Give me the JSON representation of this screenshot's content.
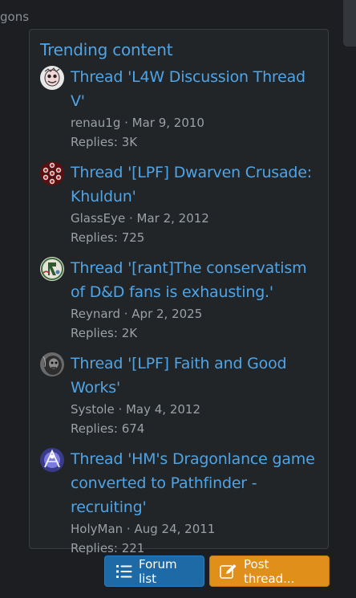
{
  "top_crumb": "gons",
  "panel": {
    "title": "Trending content",
    "items": [
      {
        "title": "Thread 'L4W Discussion Thread V'",
        "author": "renau1g",
        "date": "Mar 9, 2010",
        "replies": "Replies: 3K",
        "avatar_icon": "avatar-renau1g"
      },
      {
        "title": "Thread '[LPF] Dwarven Crusade: Khuldun'",
        "author": "GlassEye",
        "date": "Mar 2, 2012",
        "replies": "Replies: 725",
        "avatar_icon": "avatar-glasseye"
      },
      {
        "title": "Thread '[rant]The conservatism of D&D fans is exhausting.'",
        "author": "Reynard",
        "date": "Apr 2, 2025",
        "replies": "Replies: 2K",
        "avatar_icon": "avatar-reynard"
      },
      {
        "title": "Thread '[LPF] Faith and Good Works'",
        "author": "Systole",
        "date": "May 4, 2012",
        "replies": "Replies: 674",
        "avatar_icon": "avatar-systole"
      },
      {
        "title": "Thread 'HM's Dragonlance game converted to Pathfinder - recruiting'",
        "author": "HolyMan",
        "date": "Aug 24, 2011",
        "replies": "Replies: 221",
        "avatar_icon": "avatar-holyman"
      }
    ]
  },
  "buttons": {
    "forum_list": "Forum list",
    "post_thread": "Post thread..."
  },
  "colors": {
    "link": "#4fa4e6",
    "muted": "#9aa0a6",
    "forum_btn": "#1d6aa6",
    "post_btn": "#e08f1a"
  }
}
